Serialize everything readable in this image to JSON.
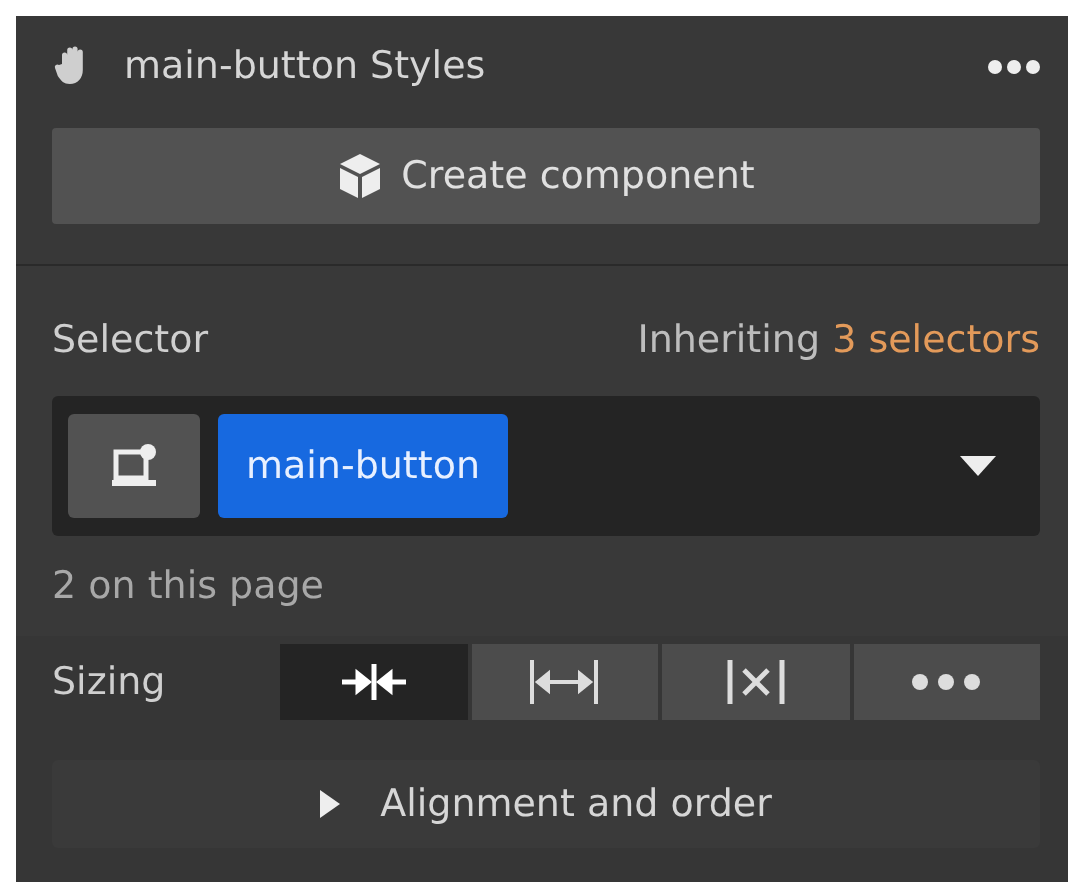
{
  "header": {
    "title": "main-button Styles"
  },
  "create_button": {
    "label": "Create component"
  },
  "selector": {
    "label": "Selector",
    "inheriting": "Inheriting",
    "inherit_count": "3 selectors",
    "tag": "main-button",
    "usage": "2 on this page"
  },
  "sizing": {
    "label": "Sizing",
    "options": [
      {
        "kind": "shrink",
        "selected": true
      },
      {
        "kind": "stretch",
        "selected": false
      },
      {
        "kind": "none",
        "selected": false
      },
      {
        "kind": "more",
        "selected": false
      }
    ]
  },
  "alignment": {
    "label": "Alignment and order",
    "expanded": false
  }
}
